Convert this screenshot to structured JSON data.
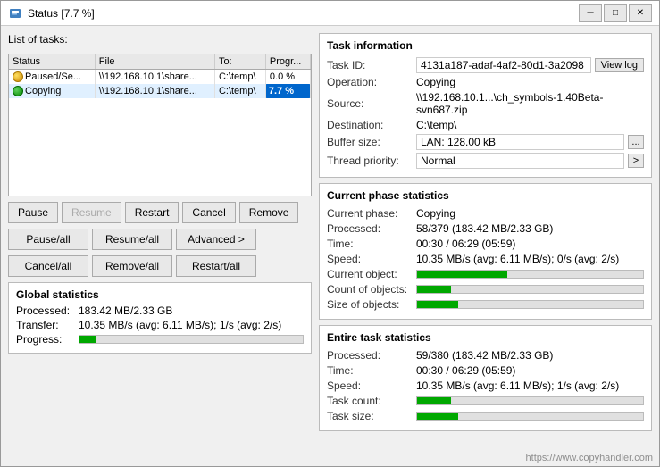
{
  "title_bar": {
    "title": "Status [7.7 %]",
    "min_label": "─",
    "max_label": "□",
    "close_label": "✕"
  },
  "left_panel": {
    "tasks_label": "List of tasks:",
    "table": {
      "headers": [
        "Status",
        "File",
        "To:",
        "Progr..."
      ],
      "rows": [
        {
          "status": "Paused/Se...",
          "status_type": "paused",
          "file": "\\\\192.168.10.1\\share...",
          "to": "C:\\temp\\",
          "progress": "0.0 %"
        },
        {
          "status": "Copying",
          "status_type": "copying",
          "file": "\\\\192.168.10.1\\share...",
          "to": "C:\\temp\\",
          "progress": "7.7 %"
        }
      ]
    },
    "buttons_row1": {
      "pause": "Pause",
      "resume": "Resume",
      "restart": "Restart",
      "cancel": "Cancel",
      "remove": "Remove"
    },
    "buttons_row2": {
      "pause_all": "Pause/all",
      "resume_all": "Resume/all",
      "advanced": "Advanced >"
    },
    "buttons_row3": {
      "cancel_all": "Cancel/all",
      "remove_all": "Remove/all",
      "restart_all": "Restart/all"
    },
    "global_stats": {
      "title": "Global statistics",
      "processed_label": "Processed:",
      "processed_value": "183.42 MB/2.33 GB",
      "transfer_label": "Transfer:",
      "transfer_value": "10.35 MB/s (avg: 6.11 MB/s); 1/s (avg: 2/s)",
      "progress_label": "Progress:"
    }
  },
  "right_panel": {
    "task_info": {
      "title": "Task information",
      "task_id_label": "Task ID:",
      "task_id_value": "4131a187-adaf-4af2-80d1-3a2098",
      "view_log_label": "View log",
      "operation_label": "Operation:",
      "operation_value": "Copying",
      "source_label": "Source:",
      "source_value": "\\\\192.168.10.1...\\ch_symbols-1.40Beta-svn687.zip",
      "destination_label": "Destination:",
      "destination_value": "C:\\temp\\",
      "buffer_label": "Buffer size:",
      "buffer_value": "LAN: 128.00 kB",
      "buffer_btn": "...",
      "thread_label": "Thread priority:",
      "thread_value": "Normal",
      "thread_btn": ">"
    },
    "current_phase": {
      "title": "Current phase statistics",
      "phase_label": "Current phase:",
      "phase_value": "Copying",
      "processed_label": "Processed:",
      "processed_value": "58/379 (183.42 MB/2.33 GB)",
      "time_label": "Time:",
      "time_value": "00:30 / 06:29 (05:59)",
      "speed_label": "Speed:",
      "speed_value": "10.35 MB/s (avg: 6.11 MB/s); 0/s (avg: 2/s)",
      "current_obj_label": "Current object:",
      "count_obj_label": "Count of objects:",
      "size_obj_label": "Size of objects:",
      "current_obj_progress": 40,
      "count_obj_progress": 15,
      "size_obj_progress": 18
    },
    "entire_task": {
      "title": "Entire task statistics",
      "processed_label": "Processed:",
      "processed_value": "59/380 (183.42 MB/2.33 GB)",
      "time_label": "Time:",
      "time_value": "00:30 / 06:29 (05:59)",
      "speed_label": "Speed:",
      "speed_value": "10.35 MB/s (avg: 6.11 MB/s); 1/s (avg: 2/s)",
      "task_count_label": "Task count:",
      "task_size_label": "Task size:",
      "task_count_progress": 15,
      "task_size_progress": 18
    }
  },
  "watermark": "https://www.copyhandler.com"
}
